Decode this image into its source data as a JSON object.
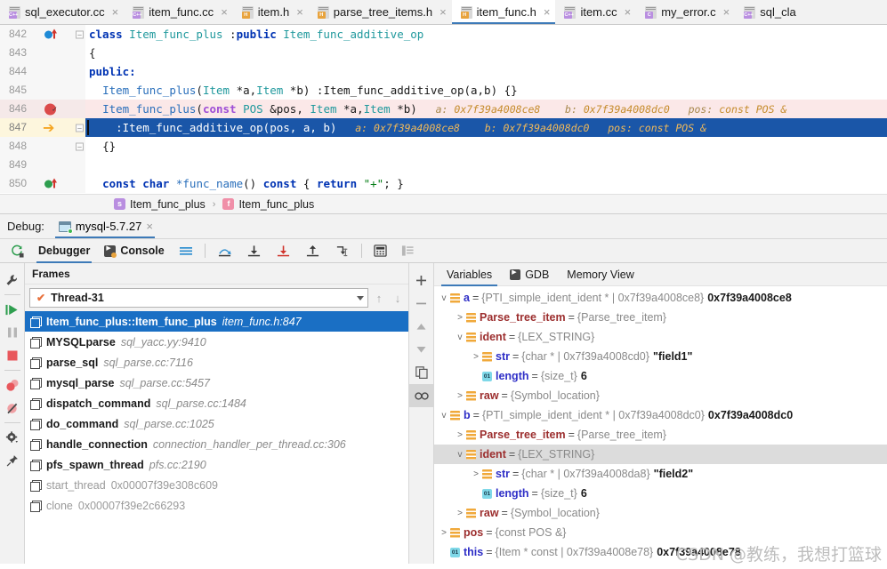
{
  "tabs": [
    {
      "label": "sql_executor.cc",
      "kind": "cpp",
      "badge": "C++",
      "active": false
    },
    {
      "label": "item_func.cc",
      "kind": "cpp",
      "badge": "C++",
      "active": false
    },
    {
      "label": "item.h",
      "kind": "h",
      "badge": "H",
      "active": false
    },
    {
      "label": "parse_tree_items.h",
      "kind": "h",
      "badge": "H",
      "active": false
    },
    {
      "label": "item_func.h",
      "kind": "h",
      "badge": "H",
      "active": true
    },
    {
      "label": "item.cc",
      "kind": "cpp",
      "badge": "C++",
      "active": false
    },
    {
      "label": "my_error.c",
      "kind": "c",
      "badge": "C",
      "active": false
    },
    {
      "label": "sql_cla",
      "kind": "cpp",
      "badge": "C++",
      "active": false
    }
  ],
  "editor": {
    "lines": [
      {
        "num": "842",
        "gutter": "override-blue",
        "fold": "collapse"
      },
      {
        "num": "843",
        "gutter": "",
        "fold": ""
      },
      {
        "num": "844",
        "gutter": "",
        "fold": ""
      },
      {
        "num": "845",
        "gutter": "",
        "fold": ""
      },
      {
        "num": "846",
        "gutter": "breakpoint",
        "fold": ""
      },
      {
        "num": "847",
        "gutter": "exec-arrow",
        "fold": "collapse"
      },
      {
        "num": "848",
        "gutter": "",
        "fold": "collapse"
      },
      {
        "num": "849",
        "gutter": "",
        "fold": ""
      },
      {
        "num": "850",
        "gutter": "override-green",
        "fold": ""
      }
    ],
    "code": {
      "l842_kw_class": "class",
      "l842_name": "Item_func_plus",
      "l842_colon": " :",
      "l842_public": "public",
      "l842_base": " Item_func_additive_op",
      "l843": "{",
      "l844": "public:",
      "l845_ctor": "Item_func_plus",
      "l845_p1": "(",
      "l845_item1": "Item",
      "l845_a": " *a,",
      "l845_item2": "Item",
      "l845_b": " *b) :",
      "l845_base": "Item_func_additive_op",
      "l845_args": "(a,b) {}",
      "l846_ctor": "Item_func_plus",
      "l846_p1": "(",
      "l846_const": "const",
      "l846_pos": " POS",
      "l846_amp": " &pos, ",
      "l846_item1": "Item",
      "l846_a": " *a,",
      "l846_item2": "Item",
      "l846_b": " *b)",
      "l847_init": ":Item_func_additive_op(pos, a, b)",
      "l848": "{}",
      "l850_const1": "const",
      "l850_char": " char",
      "l850_fn": " *func_name",
      "l850_paren": "() ",
      "l850_const2": "const",
      "l850_brace1": " { ",
      "l850_return": "return",
      "l850_str": " \"+\"",
      "l850_end": "; }"
    },
    "inline_hints": {
      "a_label": "a:",
      "a_value": "0x7f39a4008ce8",
      "b_label": "b:",
      "b_value": "0x7f39a4008dc0",
      "pos_label": "pos:",
      "pos_value": "const POS &"
    }
  },
  "breadcrumb": {
    "items": [
      {
        "badge": "s",
        "label": "Item_func_plus",
        "badge_class": "bc-s"
      },
      {
        "badge": "f",
        "label": "Item_func_plus",
        "badge_class": "bc-f"
      }
    ],
    "separator": "›"
  },
  "debug_header": {
    "label": "Debug:",
    "config_name": "mysql-5.7.27",
    "close": "×"
  },
  "debug_toolbar": {
    "rerun_icon": "rerun-icon",
    "tabs": [
      {
        "label": "Debugger",
        "selected": true
      },
      {
        "label": "Console",
        "selected": false
      }
    ],
    "buttons": [
      {
        "name": "layout-settings-icon",
        "glyph": "≡"
      },
      {
        "name": "step-over-icon",
        "glyph": "step-over"
      },
      {
        "name": "step-into-icon",
        "glyph": "step-into"
      },
      {
        "name": "force-step-into-icon",
        "glyph": "force-step-into"
      },
      {
        "name": "step-out-icon",
        "glyph": "step-out"
      },
      {
        "name": "run-to-cursor-icon",
        "glyph": "run-to-cursor"
      },
      {
        "name": "evaluate-expression-icon",
        "glyph": "calculator"
      },
      {
        "name": "show-values-inline-icon",
        "glyph": "inline-values"
      }
    ]
  },
  "left_rail": [
    {
      "name": "settings-wrench-icon",
      "glyph": "wrench"
    },
    {
      "name": "resume-program-icon",
      "glyph": "resume"
    },
    {
      "name": "pause-program-icon",
      "glyph": "pause"
    },
    {
      "name": "stop-icon",
      "glyph": "stop"
    },
    {
      "name": "view-breakpoints-icon",
      "glyph": "breakpoints"
    },
    {
      "name": "mute-breakpoints-icon",
      "glyph": "mute-breakpoints"
    },
    {
      "name": "settings-gear-icon",
      "glyph": "gear"
    },
    {
      "name": "pin-tab-icon",
      "glyph": "pin"
    }
  ],
  "mid_rail": [
    {
      "name": "add-watch-icon",
      "glyph": "+"
    },
    {
      "name": "remove-watch-icon",
      "glyph": "−"
    },
    {
      "name": "move-up-icon",
      "glyph": "▲"
    },
    {
      "name": "move-down-icon",
      "glyph": "▼"
    },
    {
      "name": "copy-value-icon",
      "glyph": "copy"
    },
    {
      "name": "watches-icon",
      "glyph": "watches"
    }
  ],
  "frames": {
    "title": "Frames",
    "thread": {
      "label": "Thread-31",
      "check": "✔"
    },
    "nav_up": "↑",
    "nav_down": "↓",
    "rows": [
      {
        "name": "Item_func_plus::Item_func_plus",
        "loc": "item_func.h:847",
        "selected": true,
        "dim": false
      },
      {
        "name": "MYSQLparse",
        "loc": "sql_yacc.yy:9410",
        "selected": false,
        "dim": false
      },
      {
        "name": "parse_sql",
        "loc": "sql_parse.cc:7116",
        "selected": false,
        "dim": false
      },
      {
        "name": "mysql_parse",
        "loc": "sql_parse.cc:5457",
        "selected": false,
        "dim": false
      },
      {
        "name": "dispatch_command",
        "loc": "sql_parse.cc:1484",
        "selected": false,
        "dim": false
      },
      {
        "name": "do_command",
        "loc": "sql_parse.cc:1025",
        "selected": false,
        "dim": false
      },
      {
        "name": "handle_connection",
        "loc": "connection_handler_per_thread.cc:306",
        "selected": false,
        "dim": false
      },
      {
        "name": "pfs_spawn_thread",
        "loc": "pfs.cc:2190",
        "selected": false,
        "dim": false
      },
      {
        "name": "start_thread",
        "loc": "0x00007f39e308c609",
        "selected": false,
        "dim": true
      },
      {
        "name": "clone",
        "loc": "0x00007f39e2c66293",
        "selected": false,
        "dim": true
      }
    ]
  },
  "variables": {
    "tabs": [
      {
        "label": "Variables",
        "selected": true,
        "icon": ""
      },
      {
        "label": "GDB",
        "selected": false,
        "icon": "gdb-icon"
      },
      {
        "label": "Memory View",
        "selected": false,
        "icon": ""
      }
    ],
    "rows": [
      {
        "indent": 0,
        "twisty": "v",
        "icon": "struct",
        "name": "a",
        "eq": "=",
        "type": "{PTI_simple_ident_ident * | 0x7f39a4008ce8}",
        "value": "0x7f39a4008ce8",
        "name_color": "blue",
        "hl": false
      },
      {
        "indent": 1,
        "twisty": ">",
        "icon": "struct",
        "name": "Parse_tree_item",
        "eq": "=",
        "type": "{Parse_tree_item}",
        "value": "",
        "name_color": "red",
        "hl": false
      },
      {
        "indent": 1,
        "twisty": "v",
        "icon": "struct",
        "name": "ident",
        "eq": "=",
        "type": "{LEX_STRING}",
        "value": "",
        "name_color": "red",
        "hl": false
      },
      {
        "indent": 2,
        "twisty": ">",
        "icon": "struct",
        "name": "str",
        "eq": "=",
        "type": "{char * | 0x7f39a4008cd0}",
        "value": "\"field1\"",
        "name_color": "blue",
        "hl": false
      },
      {
        "indent": 2,
        "twisty": "",
        "icon": "prim",
        "name": "length",
        "eq": "=",
        "type": "{size_t}",
        "value": "6",
        "name_color": "blue",
        "hl": false
      },
      {
        "indent": 1,
        "twisty": ">",
        "icon": "struct",
        "name": "raw",
        "eq": "=",
        "type": "{Symbol_location}",
        "value": "",
        "name_color": "red",
        "hl": false
      },
      {
        "indent": 0,
        "twisty": "v",
        "icon": "struct",
        "name": "b",
        "eq": "=",
        "type": "{PTI_simple_ident_ident * | 0x7f39a4008dc0}",
        "value": "0x7f39a4008dc0",
        "name_color": "blue",
        "hl": false
      },
      {
        "indent": 1,
        "twisty": ">",
        "icon": "struct",
        "name": "Parse_tree_item",
        "eq": "=",
        "type": "{Parse_tree_item}",
        "value": "",
        "name_color": "red",
        "hl": false
      },
      {
        "indent": 1,
        "twisty": "v",
        "icon": "struct",
        "name": "ident",
        "eq": "=",
        "type": "{LEX_STRING}",
        "value": "",
        "name_color": "red",
        "hl": true
      },
      {
        "indent": 2,
        "twisty": ">",
        "icon": "struct",
        "name": "str",
        "eq": "=",
        "type": "{char * | 0x7f39a4008da8}",
        "value": "\"field2\"",
        "name_color": "blue",
        "hl": false
      },
      {
        "indent": 2,
        "twisty": "",
        "icon": "prim",
        "name": "length",
        "eq": "=",
        "type": "{size_t}",
        "value": "6",
        "name_color": "blue",
        "hl": false
      },
      {
        "indent": 1,
        "twisty": ">",
        "icon": "struct",
        "name": "raw",
        "eq": "=",
        "type": "{Symbol_location}",
        "value": "",
        "name_color": "red",
        "hl": false
      },
      {
        "indent": 0,
        "twisty": ">",
        "icon": "struct",
        "name": "pos",
        "eq": "=",
        "type": "{const POS &}",
        "value": "",
        "name_color": "red",
        "hl": false
      },
      {
        "indent": 0,
        "twisty": "",
        "icon": "prim",
        "name": "this",
        "eq": "=",
        "type": "{Item * const | 0x7f39a4008e78}",
        "value": "0x7f39a4008e78",
        "name_color": "blue",
        "hl": false
      }
    ]
  },
  "watermark": "CSDN @教练，我想打篮球",
  "colors": {
    "accent": "#3d7ab8",
    "selection": "#1a6fc4",
    "breakpoint": "#db4a4a",
    "exec_arrow": "#f5a623",
    "exec_line": "#1a56a8",
    "bp_line": "#fbe8e8",
    "inline_hint": "#c58b2b"
  }
}
